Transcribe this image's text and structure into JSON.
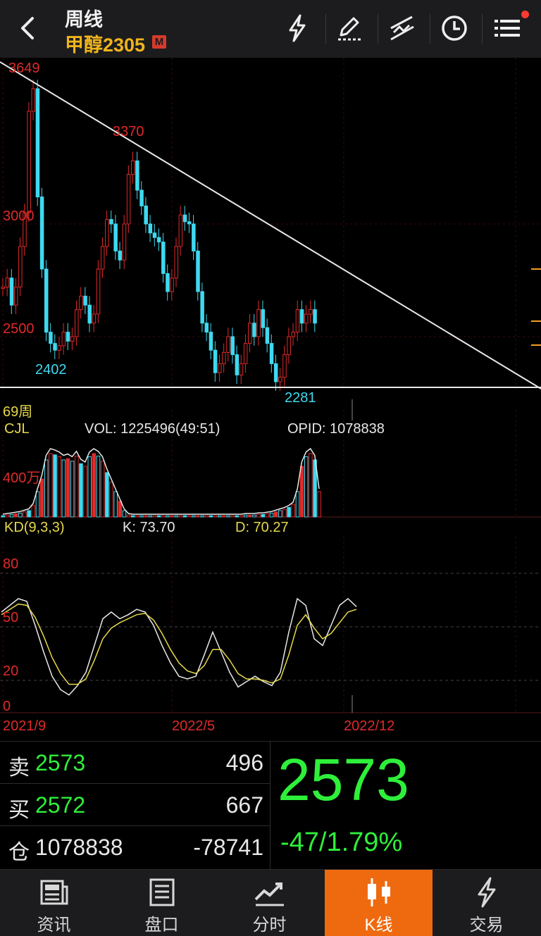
{
  "header": {
    "title": "周线",
    "subtitle": "甲醇2305",
    "badge": "M"
  },
  "colors": {
    "up": "#e02a2a",
    "down": "#3fd9f0",
    "accent": "#ef6a0f",
    "green": "#2ef03a",
    "yellow": "#e6d94a"
  },
  "icons": [
    "back-icon",
    "lightning-icon",
    "pen-icon",
    "trendline-icon",
    "clock-icon",
    "menu-icon"
  ],
  "main_chart": {
    "high_label": "3649",
    "second_high_label": "3370",
    "y_label_3000": "3000",
    "y_label_2500": "2500",
    "low_label": "2402",
    "second_low_label": "2281",
    "period_count": "69周"
  },
  "volume_panel": {
    "name": "CJL",
    "vol": "VOL: 1225496(49:51)",
    "opid": "OPID: 1078838",
    "y_label": "400万"
  },
  "kd_panel": {
    "name": "KD(9,3,3)",
    "k": "K: 73.70",
    "d": "D: 70.27",
    "levels": [
      "80",
      "50",
      "20",
      "0"
    ]
  },
  "x_axis": [
    "2021/9",
    "2022/5",
    "2022/12"
  ],
  "quote": {
    "sell_key": "卖",
    "sell_price": "2573",
    "sell_vol": "496",
    "buy_key": "买",
    "buy_price": "2572",
    "buy_vol": "667",
    "oi_key": "仓",
    "oi_value": "1078838",
    "oi_change": "-78741",
    "last_price": "2573",
    "change": "-47/1.79%"
  },
  "tabs": [
    {
      "label": "资讯",
      "icon": "news-icon"
    },
    {
      "label": "盘口",
      "icon": "orderbook-icon"
    },
    {
      "label": "分时",
      "icon": "intraday-icon"
    },
    {
      "label": "K线",
      "icon": "candlestick-icon",
      "active": true
    },
    {
      "label": "交易",
      "icon": "trade-lightning-icon"
    }
  ]
}
